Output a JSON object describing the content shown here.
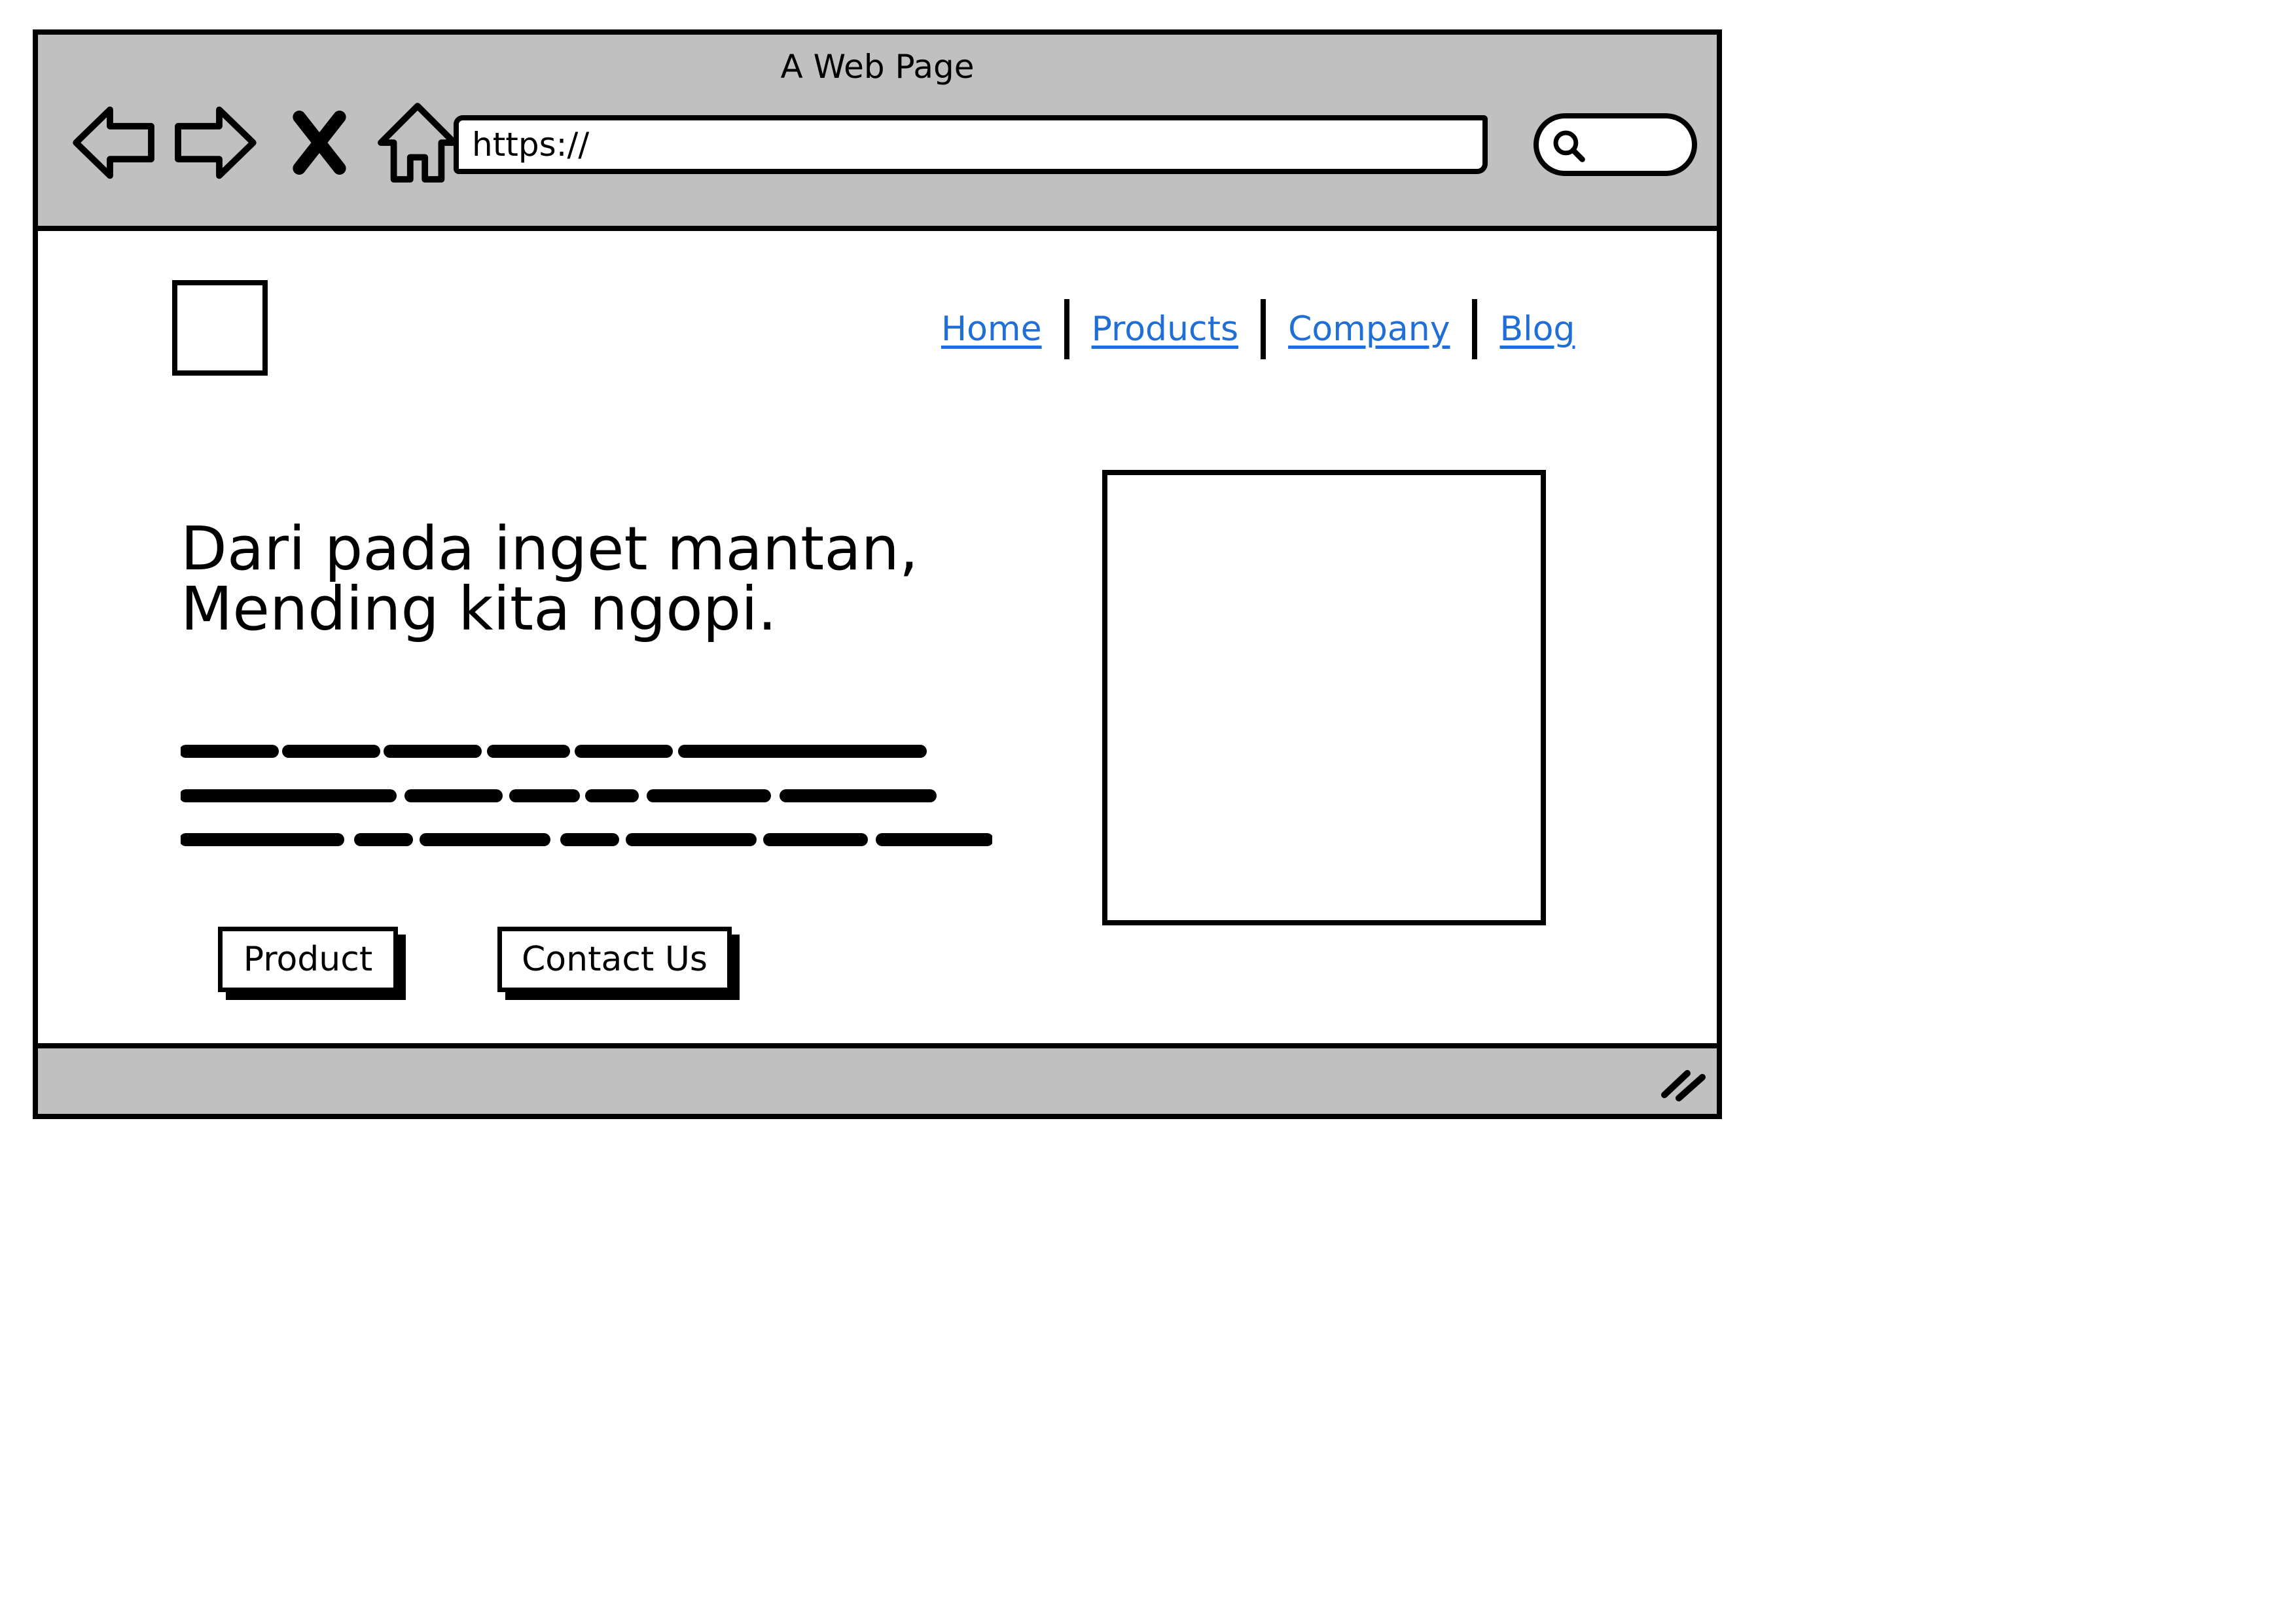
{
  "window": {
    "title": "A Web Page",
    "url": "https://"
  },
  "toolbar": {
    "icons": [
      "back-arrow-icon",
      "forward-arrow-icon",
      "stop-icon",
      "home-icon",
      "search-icon"
    ]
  },
  "site_nav": {
    "links": [
      "Home",
      "Products",
      "Company",
      "Blog"
    ],
    "link_color": "#1f6fd6"
  },
  "hero": {
    "heading": "Dari pada inget mantan, Mending kita ngopi.",
    "buttons": {
      "product": "Product",
      "contact": "Contact Us"
    }
  },
  "colors": {
    "chrome": "#c0c0c0",
    "stroke": "#000000",
    "background": "#ffffff"
  }
}
